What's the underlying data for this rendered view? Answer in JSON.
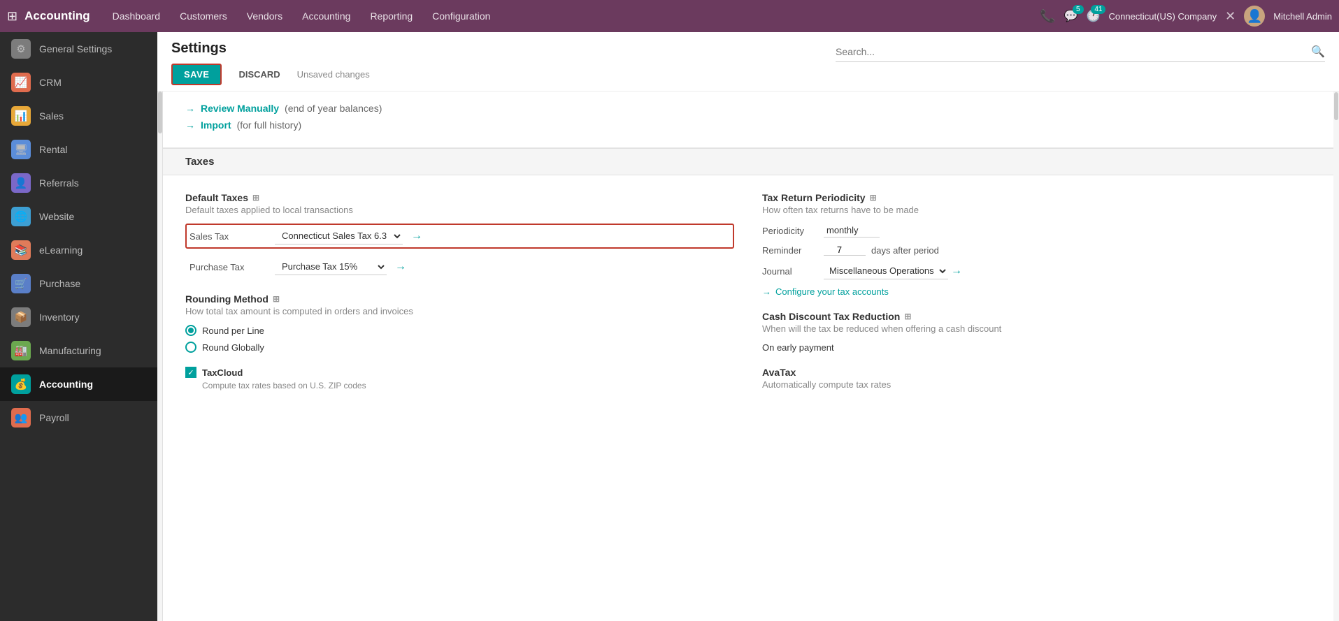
{
  "nav": {
    "apps_icon": "⊞",
    "brand": "Accounting",
    "links": [
      "Dashboard",
      "Customers",
      "Vendors",
      "Accounting",
      "Reporting",
      "Configuration"
    ],
    "company": "Connecticut(US) Company",
    "user": "Mitchell Admin",
    "badge_chat": "5",
    "badge_activity": "41"
  },
  "sidebar": {
    "items": [
      {
        "id": "general-settings",
        "label": "General Settings",
        "icon": "⚙",
        "iconClass": "icon-general"
      },
      {
        "id": "crm",
        "label": "CRM",
        "icon": "📈",
        "iconClass": "icon-crm"
      },
      {
        "id": "sales",
        "label": "Sales",
        "icon": "📊",
        "iconClass": "icon-sales"
      },
      {
        "id": "rental",
        "label": "Rental",
        "icon": "🖥",
        "iconClass": "icon-rental"
      },
      {
        "id": "referrals",
        "label": "Referrals",
        "icon": "👤",
        "iconClass": "icon-referrals"
      },
      {
        "id": "website",
        "label": "Website",
        "icon": "🌐",
        "iconClass": "icon-website"
      },
      {
        "id": "elearning",
        "label": "eLearning",
        "icon": "📚",
        "iconClass": "icon-elearning"
      },
      {
        "id": "purchase",
        "label": "Purchase",
        "icon": "🛒",
        "iconClass": "icon-purchase"
      },
      {
        "id": "inventory",
        "label": "Inventory",
        "icon": "📦",
        "iconClass": "icon-inventory"
      },
      {
        "id": "manufacturing",
        "label": "Manufacturing",
        "icon": "🏭",
        "iconClass": "icon-manufacturing"
      },
      {
        "id": "accounting",
        "label": "Accounting",
        "icon": "💰",
        "iconClass": "icon-accounting",
        "active": true
      },
      {
        "id": "payroll",
        "label": "Payroll",
        "icon": "👥",
        "iconClass": "icon-payroll"
      }
    ]
  },
  "page": {
    "title": "Settings",
    "search_placeholder": "Search...",
    "toolbar": {
      "save_label": "SAVE",
      "discard_label": "DISCARD",
      "unsaved_label": "Unsaved changes"
    }
  },
  "top_links": [
    {
      "text": "Review Manually",
      "suffix": "(end of year balances)"
    },
    {
      "text": "Import",
      "suffix": "(for full history)"
    }
  ],
  "taxes_section": {
    "title": "Taxes",
    "left": {
      "title": "Default Taxes",
      "description": "Default taxes applied to local transactions",
      "rows": [
        {
          "label": "Sales Tax",
          "value": "Connecticut Sales Tax 6.3",
          "highlighted": true,
          "arrow": true
        },
        {
          "label": "Purchase Tax",
          "value": "Purchase Tax 15%",
          "highlighted": false,
          "arrow": true
        }
      ],
      "rounding": {
        "title": "Rounding Method",
        "description": "How total tax amount is computed in orders and invoices",
        "options": [
          {
            "label": "Round per Line",
            "checked": true
          },
          {
            "label": "Round Globally",
            "checked": false
          }
        ]
      },
      "taxcloud": {
        "checked": true,
        "label": "TaxCloud",
        "description": "Compute tax rates based on U.S. ZIP codes"
      }
    },
    "right": {
      "periodicity": {
        "title": "Tax Return Periodicity",
        "description": "How often tax returns have to be made",
        "fields": [
          {
            "label": "Periodicity",
            "value": "monthly",
            "type": "text"
          },
          {
            "label": "Reminder",
            "value": "7",
            "suffix": "days after period",
            "type": "number"
          },
          {
            "label": "Journal",
            "value": "Miscellaneous Operations",
            "type": "select",
            "arrow": true
          }
        ],
        "action_link": "Configure your tax accounts"
      },
      "cash_discount": {
        "title": "Cash Discount Tax Reduction",
        "description": "When will the tax be reduced when offering a cash discount",
        "value": "On early payment"
      },
      "avatax": {
        "label": "AvaTax",
        "description": "Automatically compute tax rates"
      }
    }
  }
}
